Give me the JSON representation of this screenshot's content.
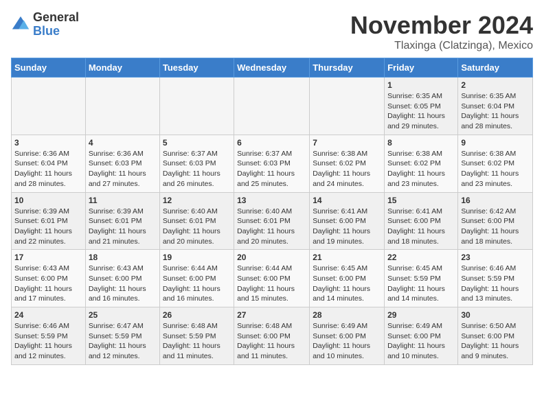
{
  "logo": {
    "line1": "General",
    "line2": "Blue"
  },
  "header": {
    "month": "November 2024",
    "location": "Tlaxinga (Clatzinga), Mexico"
  },
  "weekdays": [
    "Sunday",
    "Monday",
    "Tuesday",
    "Wednesday",
    "Thursday",
    "Friday",
    "Saturday"
  ],
  "weeks": [
    [
      {
        "day": "",
        "empty": true
      },
      {
        "day": "",
        "empty": true
      },
      {
        "day": "",
        "empty": true
      },
      {
        "day": "",
        "empty": true
      },
      {
        "day": "",
        "empty": true
      },
      {
        "day": "1",
        "sunrise": "Sunrise: 6:35 AM",
        "sunset": "Sunset: 6:05 PM",
        "daylight": "Daylight: 11 hours and 29 minutes."
      },
      {
        "day": "2",
        "sunrise": "Sunrise: 6:35 AM",
        "sunset": "Sunset: 6:04 PM",
        "daylight": "Daylight: 11 hours and 28 minutes."
      }
    ],
    [
      {
        "day": "3",
        "sunrise": "Sunrise: 6:36 AM",
        "sunset": "Sunset: 6:04 PM",
        "daylight": "Daylight: 11 hours and 28 minutes."
      },
      {
        "day": "4",
        "sunrise": "Sunrise: 6:36 AM",
        "sunset": "Sunset: 6:03 PM",
        "daylight": "Daylight: 11 hours and 27 minutes."
      },
      {
        "day": "5",
        "sunrise": "Sunrise: 6:37 AM",
        "sunset": "Sunset: 6:03 PM",
        "daylight": "Daylight: 11 hours and 26 minutes."
      },
      {
        "day": "6",
        "sunrise": "Sunrise: 6:37 AM",
        "sunset": "Sunset: 6:03 PM",
        "daylight": "Daylight: 11 hours and 25 minutes."
      },
      {
        "day": "7",
        "sunrise": "Sunrise: 6:38 AM",
        "sunset": "Sunset: 6:02 PM",
        "daylight": "Daylight: 11 hours and 24 minutes."
      },
      {
        "day": "8",
        "sunrise": "Sunrise: 6:38 AM",
        "sunset": "Sunset: 6:02 PM",
        "daylight": "Daylight: 11 hours and 23 minutes."
      },
      {
        "day": "9",
        "sunrise": "Sunrise: 6:38 AM",
        "sunset": "Sunset: 6:02 PM",
        "daylight": "Daylight: 11 hours and 23 minutes."
      }
    ],
    [
      {
        "day": "10",
        "sunrise": "Sunrise: 6:39 AM",
        "sunset": "Sunset: 6:01 PM",
        "daylight": "Daylight: 11 hours and 22 minutes."
      },
      {
        "day": "11",
        "sunrise": "Sunrise: 6:39 AM",
        "sunset": "Sunset: 6:01 PM",
        "daylight": "Daylight: 11 hours and 21 minutes."
      },
      {
        "day": "12",
        "sunrise": "Sunrise: 6:40 AM",
        "sunset": "Sunset: 6:01 PM",
        "daylight": "Daylight: 11 hours and 20 minutes."
      },
      {
        "day": "13",
        "sunrise": "Sunrise: 6:40 AM",
        "sunset": "Sunset: 6:01 PM",
        "daylight": "Daylight: 11 hours and 20 minutes."
      },
      {
        "day": "14",
        "sunrise": "Sunrise: 6:41 AM",
        "sunset": "Sunset: 6:00 PM",
        "daylight": "Daylight: 11 hours and 19 minutes."
      },
      {
        "day": "15",
        "sunrise": "Sunrise: 6:41 AM",
        "sunset": "Sunset: 6:00 PM",
        "daylight": "Daylight: 11 hours and 18 minutes."
      },
      {
        "day": "16",
        "sunrise": "Sunrise: 6:42 AM",
        "sunset": "Sunset: 6:00 PM",
        "daylight": "Daylight: 11 hours and 18 minutes."
      }
    ],
    [
      {
        "day": "17",
        "sunrise": "Sunrise: 6:43 AM",
        "sunset": "Sunset: 6:00 PM",
        "daylight": "Daylight: 11 hours and 17 minutes."
      },
      {
        "day": "18",
        "sunrise": "Sunrise: 6:43 AM",
        "sunset": "Sunset: 6:00 PM",
        "daylight": "Daylight: 11 hours and 16 minutes."
      },
      {
        "day": "19",
        "sunrise": "Sunrise: 6:44 AM",
        "sunset": "Sunset: 6:00 PM",
        "daylight": "Daylight: 11 hours and 16 minutes."
      },
      {
        "day": "20",
        "sunrise": "Sunrise: 6:44 AM",
        "sunset": "Sunset: 6:00 PM",
        "daylight": "Daylight: 11 hours and 15 minutes."
      },
      {
        "day": "21",
        "sunrise": "Sunrise: 6:45 AM",
        "sunset": "Sunset: 6:00 PM",
        "daylight": "Daylight: 11 hours and 14 minutes."
      },
      {
        "day": "22",
        "sunrise": "Sunrise: 6:45 AM",
        "sunset": "Sunset: 5:59 PM",
        "daylight": "Daylight: 11 hours and 14 minutes."
      },
      {
        "day": "23",
        "sunrise": "Sunrise: 6:46 AM",
        "sunset": "Sunset: 5:59 PM",
        "daylight": "Daylight: 11 hours and 13 minutes."
      }
    ],
    [
      {
        "day": "24",
        "sunrise": "Sunrise: 6:46 AM",
        "sunset": "Sunset: 5:59 PM",
        "daylight": "Daylight: 11 hours and 12 minutes."
      },
      {
        "day": "25",
        "sunrise": "Sunrise: 6:47 AM",
        "sunset": "Sunset: 5:59 PM",
        "daylight": "Daylight: 11 hours and 12 minutes."
      },
      {
        "day": "26",
        "sunrise": "Sunrise: 6:48 AM",
        "sunset": "Sunset: 5:59 PM",
        "daylight": "Daylight: 11 hours and 11 minutes."
      },
      {
        "day": "27",
        "sunrise": "Sunrise: 6:48 AM",
        "sunset": "Sunset: 6:00 PM",
        "daylight": "Daylight: 11 hours and 11 minutes."
      },
      {
        "day": "28",
        "sunrise": "Sunrise: 6:49 AM",
        "sunset": "Sunset: 6:00 PM",
        "daylight": "Daylight: 11 hours and 10 minutes."
      },
      {
        "day": "29",
        "sunrise": "Sunrise: 6:49 AM",
        "sunset": "Sunset: 6:00 PM",
        "daylight": "Daylight: 11 hours and 10 minutes."
      },
      {
        "day": "30",
        "sunrise": "Sunrise: 6:50 AM",
        "sunset": "Sunset: 6:00 PM",
        "daylight": "Daylight: 11 hours and 9 minutes."
      }
    ]
  ]
}
